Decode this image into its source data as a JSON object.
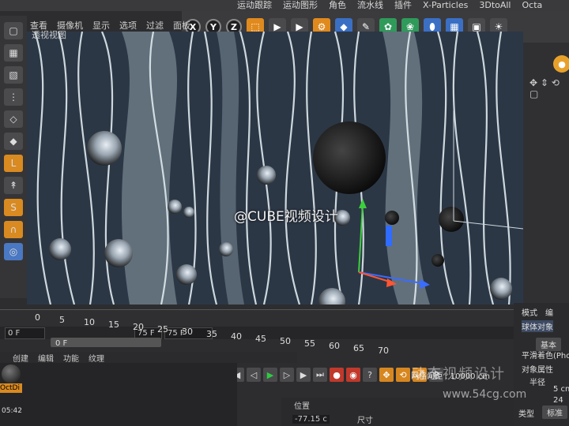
{
  "menubar": [
    "运动跟踪",
    "运动图形",
    "角色",
    "流水线",
    "插件",
    "X-Particles",
    "3DtoAll",
    "Octa"
  ],
  "viewport_menu": [
    "查看",
    "摄像机",
    "显示",
    "选项",
    "过滤",
    "面板"
  ],
  "viewport_label": "透视视图",
  "toolbar": {
    "axis_x": "X",
    "axis_y": "Y",
    "axis_z": "Z"
  },
  "watermark": "@CUBE视频设计",
  "timeline": {
    "ruler_ticks": [
      "0",
      "5",
      "10",
      "15",
      "20",
      "25",
      "30",
      "35",
      "40",
      "45",
      "50",
      "55",
      "60",
      "65",
      "70"
    ],
    "current_frame": "0 F",
    "start_frame": "0 F",
    "end_frame": "75 F",
    "end_frame_2": "75 F",
    "grid_spacing": "网格间距 : 10000 cm"
  },
  "material_menu": [
    "创建",
    "编辑",
    "功能",
    "纹理"
  ],
  "material_label": "OctDi",
  "coordinates": {
    "section": "位置",
    "size": "尺寸",
    "x_value": "-77.15 c"
  },
  "attributes": {
    "mode": "模式",
    "edit": "编",
    "object": "球体对象",
    "basic": "基本",
    "smooth": "平滑着色(Phon",
    "props": "对象属性",
    "radius_label": "半径",
    "radius_value": "5 cm",
    "segments_value": "24",
    "type_label": "类型",
    "type_value": "标准"
  },
  "status_time": "05:42",
  "brand_watermark": "动态视频设计",
  "brand_url": "www.54cg.com"
}
